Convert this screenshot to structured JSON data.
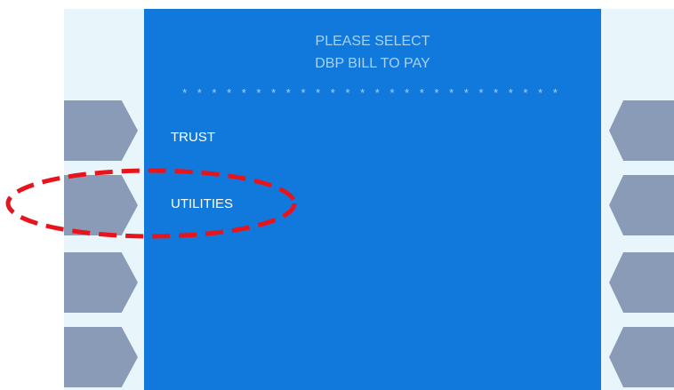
{
  "screen": {
    "title_line_1": "PLEASE SELECT",
    "title_line_2": "DBP BILL TO PAY",
    "separator": "* * * * * * * * * * * * * * * * * * * * * * * * * *",
    "options": [
      {
        "label": "TRUST"
      },
      {
        "label": "UTILITIES"
      }
    ]
  },
  "colors": {
    "screen_background": "#1279dc",
    "side_panel": "#e8f6fb",
    "side_key": "#8a9bb8",
    "title_text": "#a6d2f5",
    "option_text": "#ffffff",
    "highlight": "#e8141c"
  }
}
